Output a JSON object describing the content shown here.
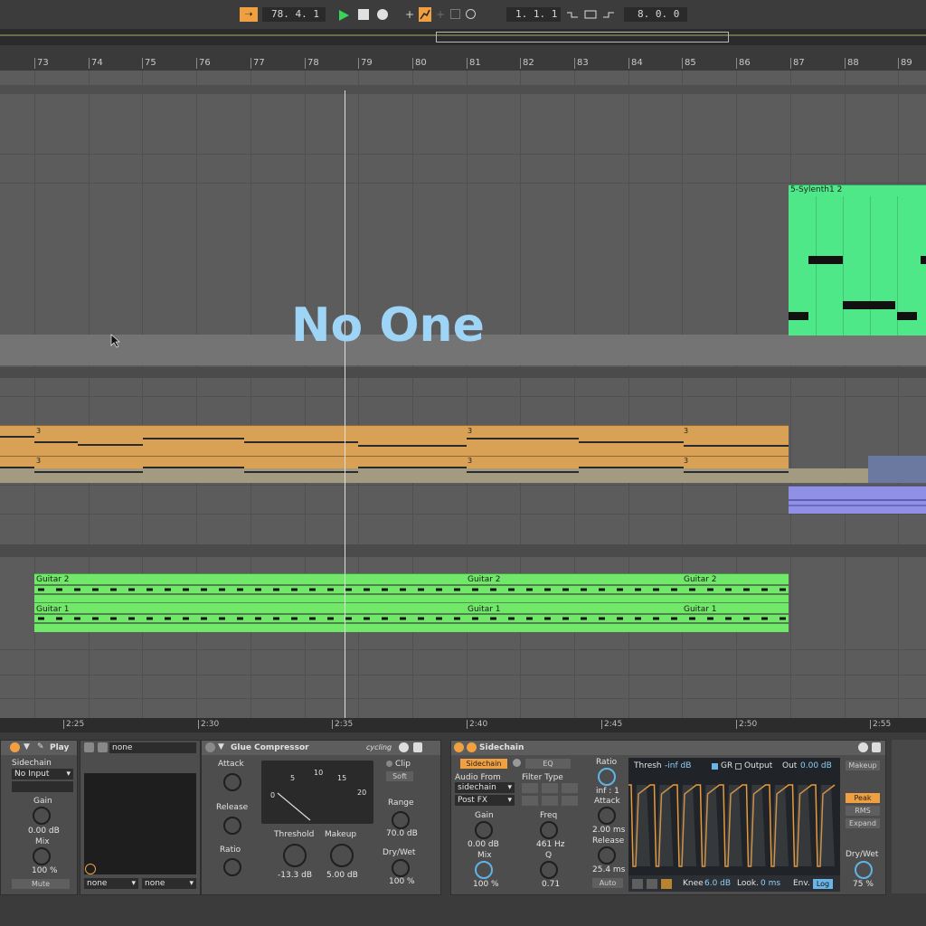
{
  "transport": {
    "position": "78. 4. 1",
    "loop_start": "1. 1. 1",
    "loop_length": "8. 0. 0"
  },
  "ruler": {
    "bars": [
      "73",
      "74",
      "75",
      "76",
      "77",
      "78",
      "79",
      "80",
      "81",
      "82",
      "83",
      "84",
      "85",
      "86",
      "87",
      "88",
      "89"
    ]
  },
  "overlay_title": "No One",
  "clips": {
    "sylenth": "5-Sylenth1 2",
    "midi_marker": "3",
    "guitar2": "Guitar 2",
    "guitar1": "Guitar 1"
  },
  "time_ruler": [
    "2:25",
    "2:30",
    "2:35",
    "2:40",
    "2:45",
    "2:50",
    "2:55"
  ],
  "colors": {
    "accent_orange": "#f0a040",
    "clip_green": "#4ee889",
    "clip_audio_green": "#72e86a",
    "clip_midi_orange": "#d9a155",
    "clip_purple": "#8f90e6",
    "playhead": "#e0e0e0"
  },
  "play_device": {
    "title": "Play",
    "sidechain_label": "Sidechain",
    "input_value": "No Input",
    "gain_label": "Gain",
    "gain_value": "0.00 dB",
    "mix_label": "Mix",
    "mix_value": "100 %",
    "mute_label": "Mute",
    "none_top": "none",
    "none_left": "none",
    "none_right": "none"
  },
  "glue": {
    "title": "Glue Compressor",
    "brand": "cycling",
    "attack_label": "Attack",
    "release_label": "Release",
    "ratio_label": "Ratio",
    "clip_label": "Clip",
    "soft_label": "Soft",
    "threshold_label": "Threshold",
    "threshold_value": "-13.3 dB",
    "makeup_label": "Makeup",
    "makeup_value": "5.00 dB",
    "range_label": "Range",
    "range_value": "70.0 dB",
    "drywet_label": "Dry/Wet",
    "drywet_value": "100 %",
    "meter_scale": [
      "0",
      "5",
      "10",
      "15",
      "20"
    ]
  },
  "sidechain": {
    "title": "Sidechain",
    "sidechain_btn": "Sidechain",
    "eq_btn": "EQ",
    "audio_from_label": "Audio From",
    "audio_from_value": "sidechain",
    "post_fx_value": "Post FX",
    "gain_label": "Gain",
    "gain_value": "0.00 dB",
    "mix_label": "Mix",
    "mix_value": "100 %",
    "filter_type_label": "Filter Type",
    "freq_label": "Freq",
    "freq_value": "461 Hz",
    "q_label": "Q",
    "q_value": "0.71",
    "ratio_label": "Ratio",
    "ratio_value": "inf : 1",
    "attack_label": "Attack",
    "attack_value": "2.00 ms",
    "release_label": "Release",
    "release_value": "25.4 ms",
    "auto_label": "Auto",
    "thresh_label": "Thresh",
    "thresh_value": "-inf dB",
    "gr_label": "GR",
    "output_label": "Output",
    "out_label": "Out",
    "out_value": "0.00 dB",
    "knee_label": "Knee",
    "knee_value": "6.0 dB",
    "look_label": "Look.",
    "look_value": "0 ms",
    "env_label": "Env.",
    "env_value": "Log",
    "makeup_btn": "Makeup",
    "peak_btn": "Peak",
    "rms_btn": "RMS",
    "expand_btn": "Expand",
    "drywet_label": "Dry/Wet",
    "drywet_value": "75 %"
  }
}
